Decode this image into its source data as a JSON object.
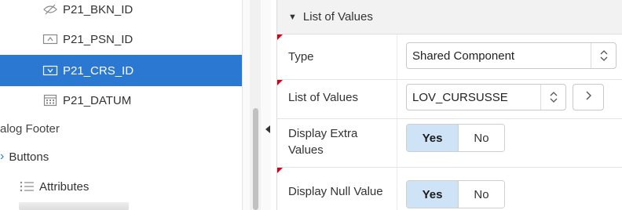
{
  "tree": {
    "items": [
      {
        "label": "P21_BKN_ID",
        "icon": "hidden-item-icon"
      },
      {
        "label": "P21_PSN_ID",
        "icon": "text-field-icon"
      },
      {
        "label": "P21_CRS_ID",
        "icon": "select-list-icon",
        "selected": true
      },
      {
        "label": "P21_DATUM",
        "icon": "date-picker-icon"
      }
    ],
    "section_dialog_footer": "alog Footer",
    "section_buttons": "Buttons",
    "section_attributes": "Attributes"
  },
  "properties": {
    "group_title": "List of Values",
    "type": {
      "label": "Type",
      "value": "Shared Component"
    },
    "list_of_values": {
      "label": "List of Values",
      "value": "LOV_CURSUSSE"
    },
    "display_extra_values": {
      "label": "Display Extra Values",
      "on": "Yes",
      "off": "No",
      "selected": "Yes"
    },
    "display_null_value": {
      "label": "Display Null Value",
      "on": "Yes",
      "off": "No",
      "selected": "Yes"
    }
  },
  "colors": {
    "selection": "#2b78d3",
    "toggle_on": "#cfe3f7",
    "required_marker": "#d4001a"
  }
}
